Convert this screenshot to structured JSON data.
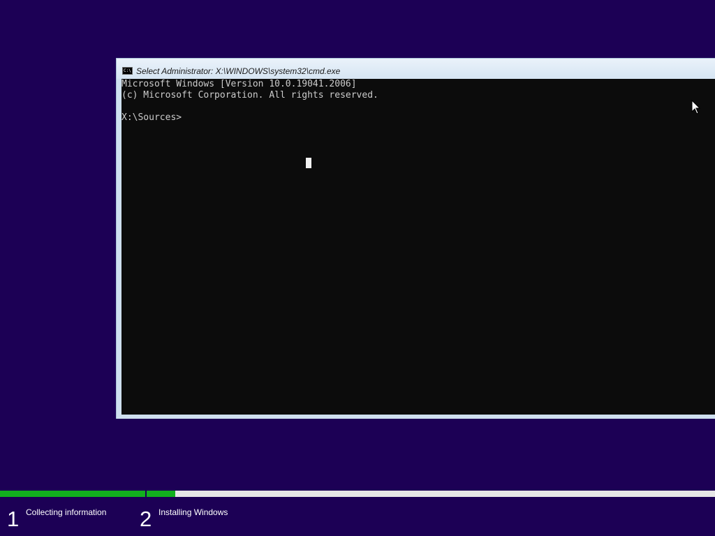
{
  "window": {
    "title": "Select Administrator: X:\\WINDOWS\\system32\\cmd.exe",
    "icon": "cmd-icon",
    "icon_text": "C:\\"
  },
  "console": {
    "lines": [
      "Microsoft Windows [Version 10.0.19041.2006]",
      "(c) Microsoft Corporation. All rights reserved.",
      "",
      "X:\\Sources>"
    ]
  },
  "setup": {
    "steps": [
      {
        "number": "1",
        "label": "Collecting information",
        "progress": 1.0
      },
      {
        "number": "2",
        "label": "Installing Windows",
        "progress": 0.05
      }
    ]
  },
  "colors": {
    "background": "#1c0055",
    "progress": "#12b01e",
    "console_bg": "#0c0c0c",
    "console_text": "#cccccc"
  }
}
